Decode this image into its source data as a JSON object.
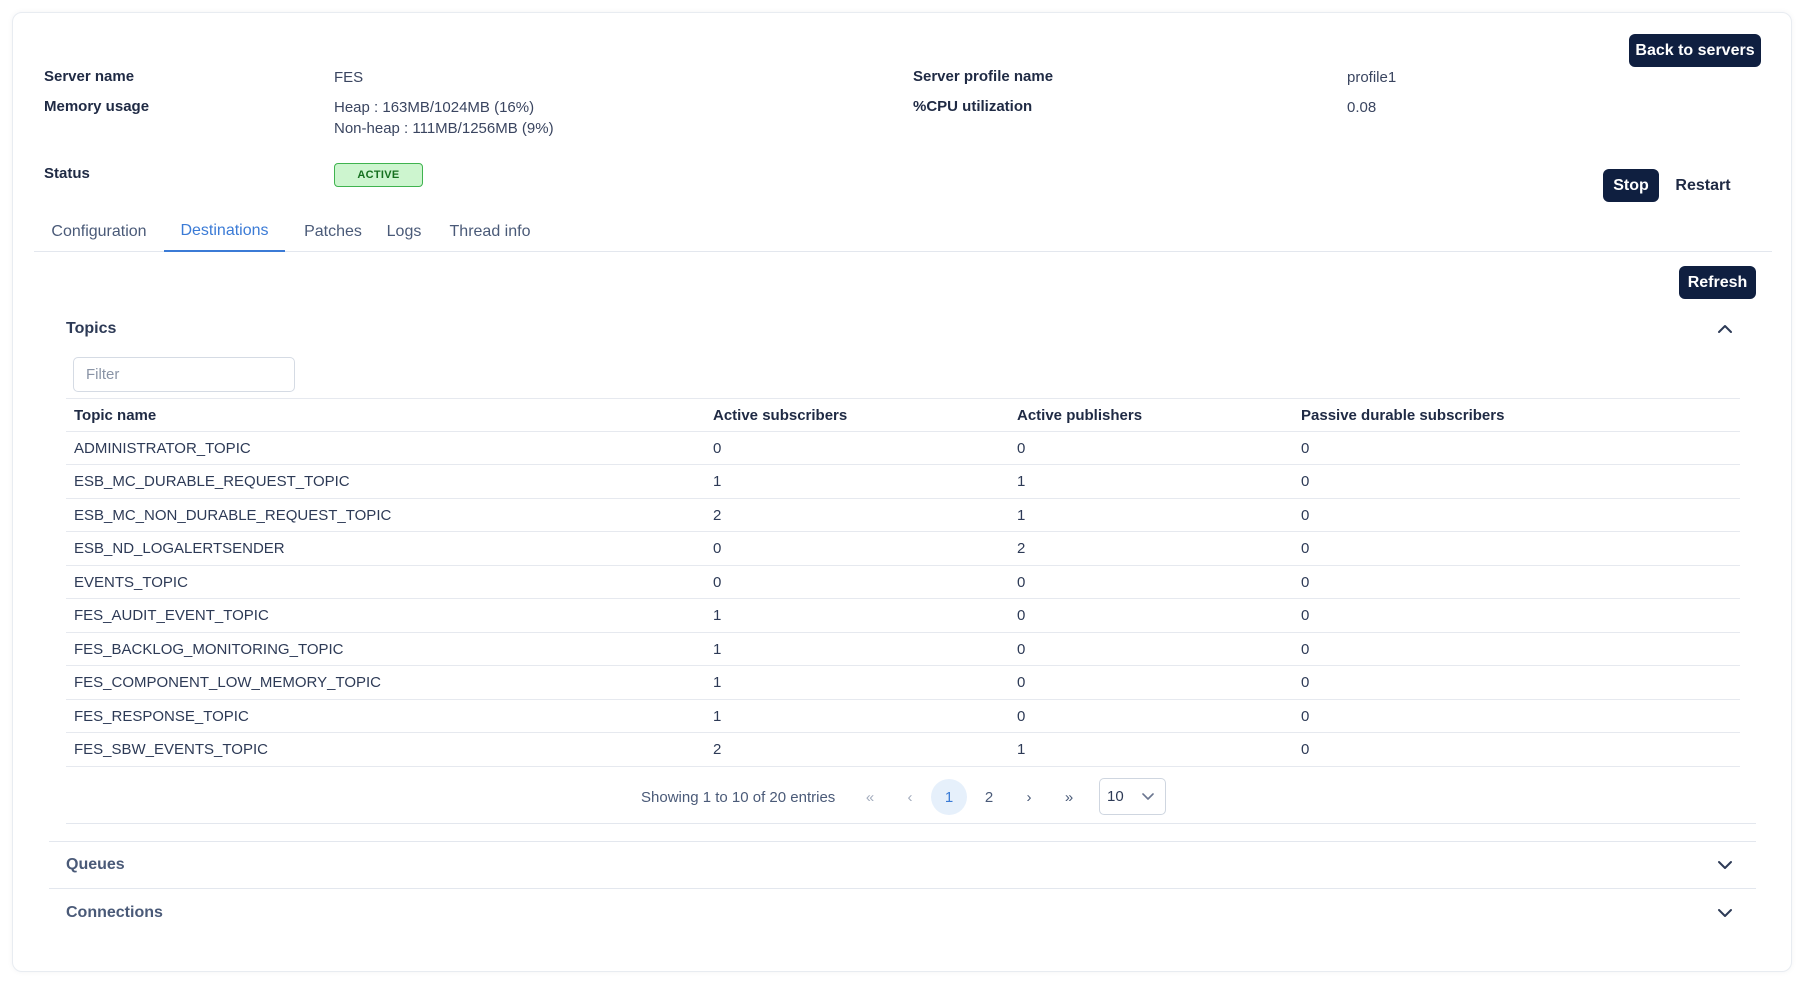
{
  "header": {
    "back_label": "Back to servers"
  },
  "server": {
    "name_label": "Server name",
    "name_value": "FES",
    "memory_label": "Memory usage",
    "heap_value": "Heap : 163MB/1024MB (16%)",
    "nonheap_value": "Non-heap : 111MB/1256MB (9%)",
    "status_label": "Status",
    "status_value": "ACTIVE",
    "profile_label": "Server profile name",
    "profile_value": "profile1",
    "cpu_label": "%CPU utilization",
    "cpu_value": "0.08"
  },
  "actions": {
    "stop_label": "Stop",
    "restart_label": "Restart",
    "refresh_label": "Refresh"
  },
  "tabs": [
    {
      "label": "Configuration",
      "active": false
    },
    {
      "label": "Destinations",
      "active": true
    },
    {
      "label": "Patches",
      "active": false
    },
    {
      "label": "Logs",
      "active": false
    },
    {
      "label": "Thread info",
      "active": false
    }
  ],
  "topics": {
    "title": "Topics",
    "filter_placeholder": "Filter",
    "columns": [
      "Topic name",
      "Active subscribers",
      "Active publishers",
      "Passive durable subscribers"
    ],
    "rows": [
      [
        "ADMINISTRATOR_TOPIC",
        "0",
        "0",
        "0"
      ],
      [
        "ESB_MC_DURABLE_REQUEST_TOPIC",
        "1",
        "1",
        "0"
      ],
      [
        "ESB_MC_NON_DURABLE_REQUEST_TOPIC",
        "2",
        "1",
        "0"
      ],
      [
        "ESB_ND_LOGALERTSENDER",
        "0",
        "2",
        "0"
      ],
      [
        "EVENTS_TOPIC",
        "0",
        "0",
        "0"
      ],
      [
        "FES_AUDIT_EVENT_TOPIC",
        "1",
        "0",
        "0"
      ],
      [
        "FES_BACKLOG_MONITORING_TOPIC",
        "1",
        "0",
        "0"
      ],
      [
        "FES_COMPONENT_LOW_MEMORY_TOPIC",
        "1",
        "0",
        "0"
      ],
      [
        "FES_RESPONSE_TOPIC",
        "1",
        "0",
        "0"
      ],
      [
        "FES_SBW_EVENTS_TOPIC",
        "2",
        "1",
        "0"
      ]
    ]
  },
  "pagination": {
    "info": "Showing 1 to 10 of 20 entries",
    "first": "«",
    "prev": "‹",
    "pages": [
      "1",
      "2"
    ],
    "current": "1",
    "next": "›",
    "last": "»",
    "page_size": "10"
  },
  "sections": {
    "queues": "Queues",
    "connections": "Connections"
  },
  "colors": {
    "primary": "#0f1f40",
    "accent": "#3b7bd6",
    "active_badge_bg": "#cdf5cf",
    "active_badge_text": "#16701f"
  }
}
